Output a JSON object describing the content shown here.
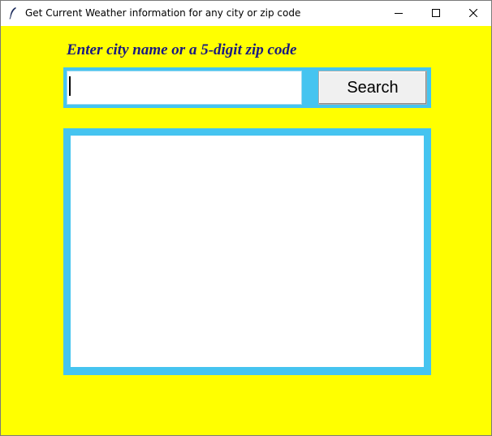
{
  "window": {
    "title": "Get Current Weather information for any city or zip code",
    "app_icon": "feather-icon",
    "controls": [
      "minimize-icon",
      "maximize-icon",
      "close-icon"
    ]
  },
  "colors": {
    "background": "#ffff00",
    "frame_accent": "#45c4f0",
    "prompt_text": "#1a1a80"
  },
  "prompt": {
    "label": "Enter city name or a 5-digit zip code"
  },
  "search": {
    "value": "",
    "placeholder": "",
    "button_label": "Search"
  },
  "results": {
    "text": ""
  }
}
